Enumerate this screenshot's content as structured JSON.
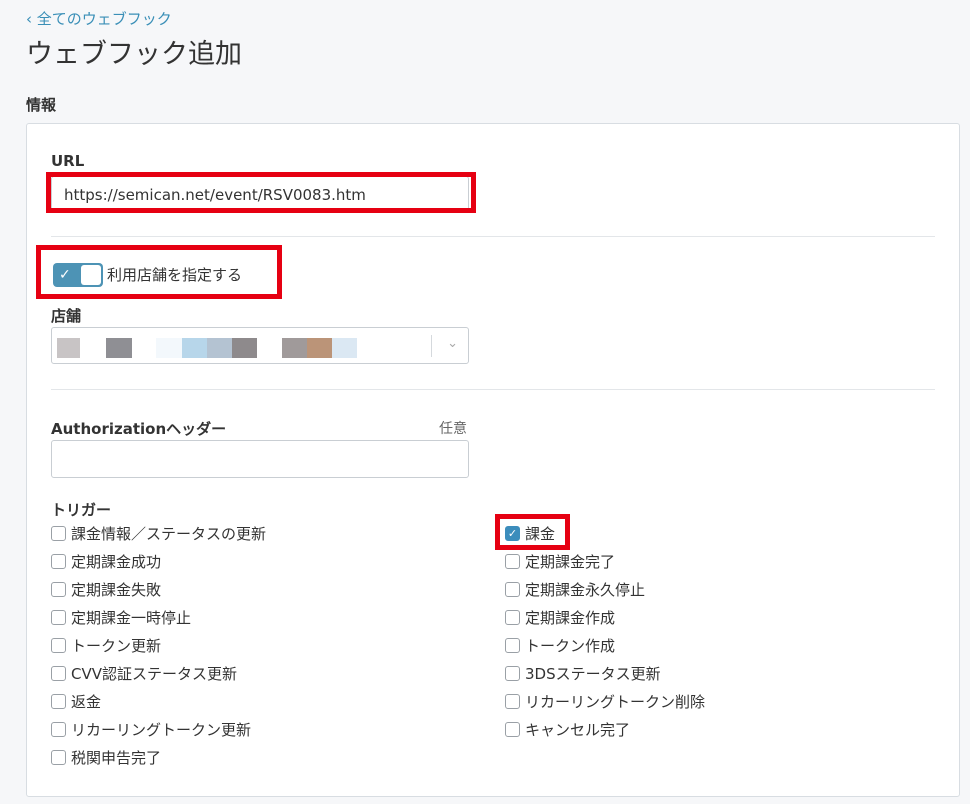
{
  "header": {
    "back_link": "‹ 全てのウェブフック",
    "title": "ウェブフック追加"
  },
  "section": {
    "heading": "情報"
  },
  "url": {
    "label": "URL",
    "value": "https://semican.net/event/RSV0083.htm"
  },
  "store_toggle": {
    "label": "利用店舗を指定する",
    "on": true
  },
  "store": {
    "label": "店舗",
    "redacted_colors": [
      "#c8c4c5",
      "#8f8f94",
      "#f3f8fc",
      "#b7d6ea",
      "#b4c3d2",
      "#8e8a8c",
      "#a09a9a",
      "#bb9478",
      "#dbe8f3"
    ]
  },
  "authorization": {
    "label": "Authorizationヘッダー",
    "optional": "任意",
    "value": ""
  },
  "triggers": {
    "label": "トリガー",
    "left": [
      {
        "label": "課金情報／ステータスの更新",
        "checked": false
      },
      {
        "label": "定期課金成功",
        "checked": false
      },
      {
        "label": "定期課金失敗",
        "checked": false
      },
      {
        "label": "定期課金一時停止",
        "checked": false
      },
      {
        "label": "トークン更新",
        "checked": false
      },
      {
        "label": "CVV認証ステータス更新",
        "checked": false
      },
      {
        "label": "返金",
        "checked": false
      },
      {
        "label": "リカーリングトークン更新",
        "checked": false
      },
      {
        "label": "税関申告完了",
        "checked": false
      }
    ],
    "right": [
      {
        "label": "課金",
        "checked": true
      },
      {
        "label": "定期課金完了",
        "checked": false
      },
      {
        "label": "定期課金永久停止",
        "checked": false
      },
      {
        "label": "定期課金作成",
        "checked": false
      },
      {
        "label": "トークン作成",
        "checked": false
      },
      {
        "label": "3DSステータス更新",
        "checked": false
      },
      {
        "label": "リカーリングトークン削除",
        "checked": false
      },
      {
        "label": "キャンセル完了",
        "checked": false
      }
    ]
  },
  "colors": {
    "accent": "#3c8dbc",
    "link": "#3a8fb7",
    "highlight": "#e60012"
  }
}
